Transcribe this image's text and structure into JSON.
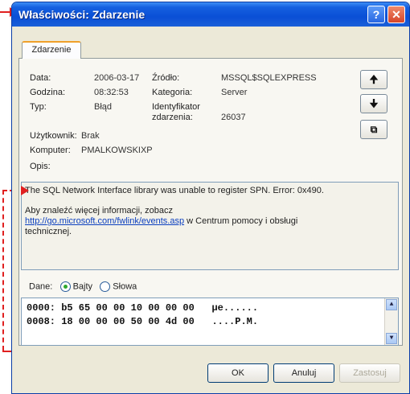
{
  "window": {
    "title": "Właściwości: Zdarzenie"
  },
  "tabs": [
    {
      "label": "Zdarzenie"
    }
  ],
  "fields": {
    "data_label": "Data:",
    "data_value": "2006-03-17",
    "godzina_label": "Godzina:",
    "godzina_value": "08:32:53",
    "typ_label": "Typ:",
    "typ_value": "Błąd",
    "uzytkownik_label": "Użytkownik:",
    "uzytkownik_value": "Brak",
    "komputer_label": "Komputer:",
    "komputer_value": "PMALKOWSKIXP",
    "zrodlo_label": "Źródło:",
    "zrodlo_value": "MSSQL$SQLEXPRESS",
    "kategoria_label": "Kategoria:",
    "kategoria_value": "Server",
    "identyfikator_label_1": "Identyfikator",
    "identyfikator_label_2": "zdarzenia:",
    "identyfikator_value": "26037"
  },
  "opis": {
    "label": "Opis:",
    "line1": "The SQL Network Interface library was unable to register SPN. Error: 0x490.",
    "line2": "Aby znaleźć więcej informacji, zobacz",
    "link": "http://go.microsoft.com/fwlink/events.asp",
    "line3": " w Centrum pomocy i obsługi",
    "line4": "technicznej."
  },
  "dane": {
    "label": "Dane:",
    "radio_bajty": "Bajty",
    "radio_slowa": "Słowa",
    "selected": "Bajty",
    "hex_lines": [
      "0000: b5 65 00 00 10 00 00 00   µe......",
      "0008: 18 00 00 00 50 00 4d 00   ....P.M."
    ]
  },
  "buttons": {
    "ok": "OK",
    "cancel": "Anuluj",
    "apply": "Zastosuj"
  },
  "icons": {
    "up": "arrow-up-icon",
    "down": "arrow-down-icon",
    "copy": "copy-icon",
    "help": "help-icon",
    "close": "close-icon"
  },
  "colors": {
    "titlebar": "#0a4fd6",
    "annotation": "#e02020",
    "link": "#0b3fbf",
    "tab_accent": "#f0a02a"
  }
}
